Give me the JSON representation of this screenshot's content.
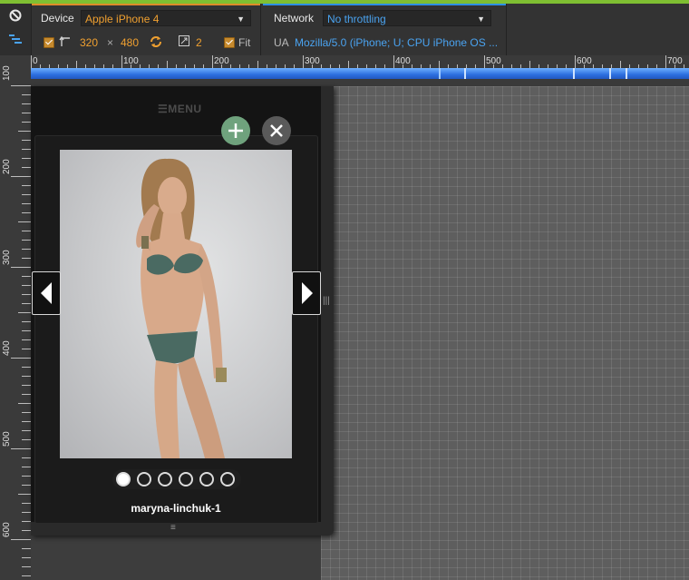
{
  "toolbar": {
    "device_label": "Device",
    "device_value": "Apple iPhone 4",
    "width": "320",
    "times": "×",
    "height": "480",
    "pixel_ratio": "2",
    "fit_label": "Fit",
    "network_label": "Network",
    "network_value": "No throttling",
    "ua_label": "UA",
    "ua_value": "Mozilla/5.0 (iPhone; U; CPU iPhone OS ..."
  },
  "ruler": {
    "h_labels": [
      "0",
      "100",
      "200",
      "300",
      "400",
      "500",
      "600",
      "700"
    ],
    "v_labels": [
      "100",
      "200",
      "300",
      "400",
      "500",
      "600"
    ]
  },
  "page": {
    "menu_label": "MENU"
  },
  "lightbox": {
    "caption": "maryna-linchuk-1",
    "slide_count": 6,
    "active_slide": 1
  },
  "colors": {
    "device_accent": "#e08b2a",
    "network_accent": "#2d8fe6",
    "top_strip": "#7fbf32",
    "add_button": "#6fa27d"
  }
}
